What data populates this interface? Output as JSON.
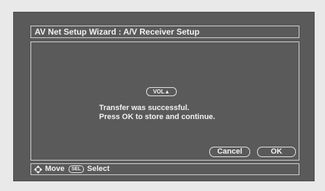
{
  "window": {
    "title": "AV Net Setup Wizard : A/V Receiver Setup"
  },
  "dialog": {
    "key_label": "VOL▲",
    "message_line1": "Transfer was successful.",
    "message_line2": "Press OK to store and continue.",
    "cancel_label": "Cancel",
    "ok_label": "OK"
  },
  "status": {
    "move_label": "Move",
    "sel_key_label": "SEL",
    "select_label": "Select",
    "move_icon": "dpad-icon"
  },
  "colors": {
    "screen_bg": "#5a5a5a",
    "text": "#f2f2f2",
    "border": "#d6d6d6",
    "outer_bg": "#e9e9e9"
  }
}
